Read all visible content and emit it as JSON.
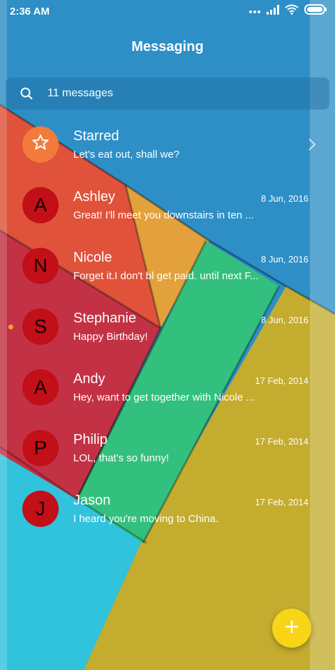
{
  "status_bar": {
    "time": "2:36 AM",
    "icons": [
      "more-dots-icon",
      "signal-icon",
      "wifi-icon",
      "battery-icon"
    ]
  },
  "header": {
    "title": "Messaging"
  },
  "search": {
    "icon": "search-icon",
    "text": "11 messages"
  },
  "starred": {
    "title": "Starred",
    "preview": "Let's eat out, shall we?",
    "icon": "star-icon"
  },
  "conversations": [
    {
      "initial": "A",
      "name": "Ashley",
      "date": "8 Jun, 2016",
      "preview": "Great! I'll meet you downstairs in ten ...",
      "unread": false
    },
    {
      "initial": "N",
      "name": "Nicole",
      "date": "8 Jun, 2016",
      "preview": "Forget it.I don't bl get paid. until next F...",
      "unread": false
    },
    {
      "initial": "S",
      "name": "Stephanie",
      "date": "8 Jun, 2016",
      "preview": "Happy Birthday!",
      "unread": true
    },
    {
      "initial": "A",
      "name": "Andy",
      "date": "17 Feb, 2014",
      "preview": "Hey, want to get together with Nicole ...",
      "unread": false
    },
    {
      "initial": "P",
      "name": "Philip",
      "date": "17 Feb, 2014",
      "preview": "LOL, that's so funny!",
      "unread": false
    },
    {
      "initial": "J",
      "name": "Jason",
      "date": "17 Feb, 2014",
      "preview": "I heard you're moving to China.",
      "unread": false
    }
  ],
  "fab": {
    "icon": "plus-icon"
  },
  "colors": {
    "background_blue": "#2d8fc6",
    "stripe_red": "#e0523a",
    "stripe_crimson": "#c33144",
    "stripe_orange": "#e2a13a",
    "stripe_green": "#33c07e",
    "stripe_olive": "#c4ac2f",
    "stripe_cyan": "#31c2dc",
    "avatar_red": "#c20f18",
    "star_orange": "#f27a3b",
    "fab_yellow": "#f8d516",
    "unread_dot": "#f6a623"
  }
}
